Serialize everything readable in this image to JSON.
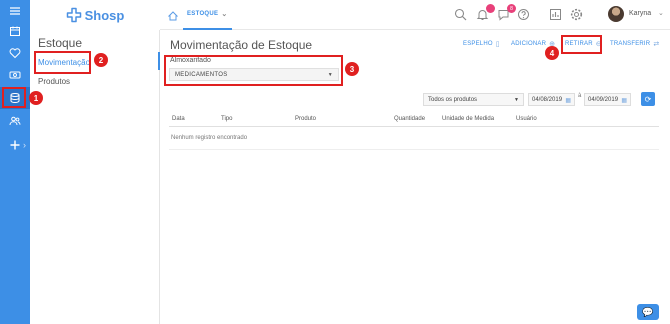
{
  "app": {
    "logo": "Shosp"
  },
  "rail": {
    "items": [
      {
        "icon": "menu-icon"
      },
      {
        "icon": "calendar-icon"
      },
      {
        "icon": "heart-icon"
      },
      {
        "icon": "money-icon"
      },
      {
        "icon": "database-icon",
        "active": true
      },
      {
        "icon": "users-icon"
      },
      {
        "icon": "plus-icon"
      }
    ],
    "expand": "›"
  },
  "subnav": {
    "title": "Estoque",
    "items": [
      {
        "label": "Movimentação",
        "active": true
      },
      {
        "label": "Produtos"
      }
    ]
  },
  "topbar": {
    "tab": "ESTOQUE",
    "notif_badge": "",
    "chat_badge": "8",
    "user": "Karyna"
  },
  "main": {
    "title": "Movimentação de Estoque",
    "actions": {
      "espelho": "ESPELHO",
      "adicionar": "ADICIONAR",
      "retirar": "RETIRAR",
      "transferir": "TRANSFERIR"
    },
    "almoxarifado_label": "Almoxarifado",
    "almoxarifado_value": "MEDICAMENTOS",
    "filter_products": "Todos os produtos",
    "date_from": "04/08/2019",
    "date_to": "04/09/2019",
    "date_sep": "à",
    "columns": [
      "Data",
      "Tipo",
      "Produto",
      "Quantidade",
      "Unidade de Medida",
      "Usuário"
    ],
    "empty_message": "Nenhum registro encontrado"
  },
  "annotations": [
    "1",
    "2",
    "3",
    "4"
  ],
  "colors": {
    "accent": "#3d8fe6",
    "annotation": "#e02020",
    "badge": "#e8407a"
  }
}
